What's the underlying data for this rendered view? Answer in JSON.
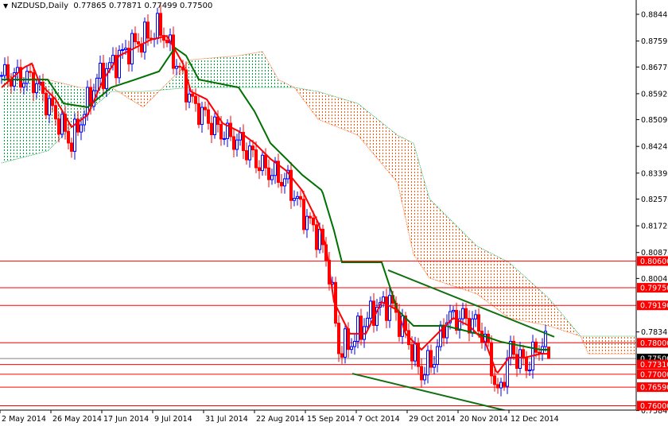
{
  "header": {
    "symbol": "NZDUSD,Daily",
    "ohlc": "0.77865 0.77871 0.77499 0.77500"
  },
  "colors": {
    "bull": "#0000ff",
    "bear": "#ff0000",
    "tenkan": "#ff0000",
    "kijun": "#007000",
    "cloud_up": "#00a040",
    "cloud_down": "#ff5000",
    "level": "#ff0000",
    "current": "#808080",
    "trend": "#107010"
  },
  "chart_data": {
    "type": "candlestick",
    "title": "NZDUSD,Daily",
    "ylim": [
      0.75845,
      0.88445
    ],
    "y_ticks": [
      "0.88445",
      "0.87595",
      "0.86770",
      "0.85920",
      "0.85095",
      "0.84245",
      "0.83395",
      "0.82570",
      "0.81720",
      "0.80870",
      "0.80045",
      "0.78345",
      "0.75845"
    ],
    "x_ticks": [
      {
        "index": 0,
        "label": "2 May 2014"
      },
      {
        "index": 16,
        "label": "26 May 2014"
      },
      {
        "index": 32,
        "label": "17 Jun 2014"
      },
      {
        "index": 48,
        "label": "9 Jul 2014"
      },
      {
        "index": 64,
        "label": "31 Jul 2014"
      },
      {
        "index": 80,
        "label": "22 Aug 2014"
      },
      {
        "index": 96,
        "label": "15 Sep 2014"
      },
      {
        "index": 112,
        "label": "7 Oct 2014"
      },
      {
        "index": 128,
        "label": "29 Oct 2014"
      },
      {
        "index": 144,
        "label": "20 Nov 2014"
      },
      {
        "index": 160,
        "label": "12 Dec 2014"
      }
    ],
    "close_path": [
      [
        0,
        0.865
      ],
      [
        10,
        0.8637
      ],
      [
        22,
        0.8435
      ],
      [
        30,
        0.8637
      ],
      [
        40,
        0.8738
      ],
      [
        50,
        0.8801
      ],
      [
        55,
        0.8688
      ],
      [
        60,
        0.8561
      ],
      [
        67,
        0.8486
      ],
      [
        75,
        0.8435
      ],
      [
        82,
        0.8359
      ],
      [
        90,
        0.8309
      ],
      [
        95,
        0.8208
      ],
      [
        100,
        0.8132
      ],
      [
        103,
        0.8031
      ],
      [
        106,
        0.7778
      ],
      [
        110,
        0.7803
      ],
      [
        117,
        0.7904
      ],
      [
        122,
        0.793
      ],
      [
        127,
        0.7829
      ],
      [
        132,
        0.7702
      ],
      [
        136,
        0.7753
      ],
      [
        140,
        0.7879
      ],
      [
        145,
        0.7879
      ],
      [
        150,
        0.7854
      ],
      [
        153,
        0.7778
      ],
      [
        156,
        0.7627
      ],
      [
        160,
        0.7778
      ],
      [
        165,
        0.7728
      ],
      [
        170,
        0.7803
      ],
      [
        171,
        0.7787
      ]
    ],
    "last_candle": {
      "open": 0.77865,
      "high": 0.77871,
      "low": 0.77499,
      "close": 0.775
    },
    "tenkan": [
      [
        0,
        0.8612
      ],
      [
        7,
        0.8675
      ],
      [
        9.5,
        0.8688
      ],
      [
        12,
        0.8625
      ],
      [
        17,
        0.8574
      ],
      [
        22,
        0.8486
      ],
      [
        27,
        0.8524
      ],
      [
        32,
        0.8637
      ],
      [
        37,
        0.8713
      ],
      [
        42,
        0.8738
      ],
      [
        47,
        0.8764
      ],
      [
        52,
        0.8776
      ],
      [
        57,
        0.8688
      ],
      [
        59.5,
        0.8599
      ],
      [
        64.5,
        0.8574
      ],
      [
        69.5,
        0.8498
      ],
      [
        74.5,
        0.8473
      ],
      [
        79.5,
        0.8435
      ],
      [
        84.5,
        0.8385
      ],
      [
        89.5,
        0.8347
      ],
      [
        94.5,
        0.8284
      ],
      [
        99.5,
        0.8182
      ],
      [
        102,
        0.8107
      ],
      [
        104.5,
        0.793
      ],
      [
        107,
        0.7879
      ],
      [
        109.5,
        0.7829
      ],
      [
        114.5,
        0.7829
      ],
      [
        119.5,
        0.793
      ],
      [
        124.5,
        0.7904
      ],
      [
        127,
        0.7829
      ],
      [
        132,
        0.7778
      ],
      [
        137,
        0.7829
      ],
      [
        142,
        0.7879
      ],
      [
        147,
        0.7854
      ],
      [
        152,
        0.7803
      ],
      [
        155.75,
        0.7702
      ],
      [
        159.5,
        0.7753
      ],
      [
        164.5,
        0.7753
      ],
      [
        169.5,
        0.7765
      ],
      [
        172.5,
        0.7765
      ]
    ],
    "kijun": [
      [
        0,
        0.8637
      ],
      [
        14.5,
        0.8637
      ],
      [
        19.5,
        0.8561
      ],
      [
        27,
        0.8549
      ],
      [
        34.5,
        0.8612
      ],
      [
        42,
        0.8637
      ],
      [
        49.5,
        0.8663
      ],
      [
        54.5,
        0.8738
      ],
      [
        58,
        0.8713
      ],
      [
        62,
        0.8637
      ],
      [
        74.5,
        0.8612
      ],
      [
        79.5,
        0.8536
      ],
      [
        84.5,
        0.8435
      ],
      [
        89.5,
        0.8385
      ],
      [
        94.5,
        0.8334
      ],
      [
        100.75,
        0.8284
      ],
      [
        104.5,
        0.8157
      ],
      [
        107,
        0.8056
      ],
      [
        119.5,
        0.8056
      ],
      [
        124.5,
        0.7904
      ],
      [
        129.5,
        0.7854
      ],
      [
        139.5,
        0.7854
      ],
      [
        149.5,
        0.7829
      ],
      [
        157,
        0.7803
      ],
      [
        169.5,
        0.7778
      ],
      [
        172.5,
        0.7778
      ]
    ],
    "cloud": [
      [
        0,
        0.865,
        0.8372
      ],
      [
        14.5,
        0.8637,
        0.841
      ],
      [
        24.5,
        0.8612,
        0.8511
      ],
      [
        34.5,
        0.8612,
        0.8599
      ],
      [
        44.5,
        0.8549,
        0.8599
      ],
      [
        59.5,
        0.87,
        0.8612
      ],
      [
        74.5,
        0.8713,
        0.8612
      ],
      [
        82,
        0.8726,
        0.8612
      ],
      [
        87,
        0.8637,
        0.8612
      ],
      [
        92,
        0.8612,
        0.8612
      ],
      [
        99.5,
        0.8511,
        0.8599
      ],
      [
        112,
        0.846,
        0.8561
      ],
      [
        124.5,
        0.8309,
        0.846
      ],
      [
        129.5,
        0.8081,
        0.8435
      ],
      [
        134.5,
        0.8006,
        0.8258
      ],
      [
        149.5,
        0.7955,
        0.8107
      ],
      [
        159.5,
        0.7879,
        0.8056
      ],
      [
        172,
        0.7854,
        0.7942
      ],
      [
        182,
        0.7821,
        0.7821
      ],
      [
        184.5,
        0.7765,
        0.7821
      ],
      [
        200,
        0.7765,
        0.7821
      ]
    ],
    "levels": [
      "0.80600",
      "0.79750",
      "0.79190",
      "0.78000",
      "0.77310",
      "0.77000",
      "0.76590",
      "0.76000"
    ],
    "current_price": "0.77500",
    "trendlines": [
      {
        "name": "upper",
        "from": [
          121.5,
          0.8031
        ],
        "to": [
          173.75,
          0.7819
        ]
      },
      {
        "name": "lower",
        "from": [
          110.25,
          0.7702
        ],
        "to": [
          158.25,
          0.7585
        ]
      }
    ]
  }
}
